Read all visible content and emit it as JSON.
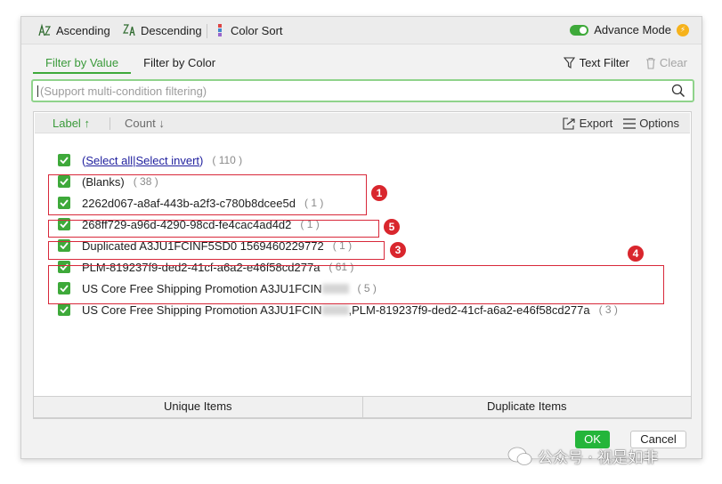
{
  "toolbar": {
    "ascending": "Ascending",
    "descending": "Descending",
    "color_sort": "Color Sort",
    "advance_mode": "Advance Mode"
  },
  "tabs": {
    "filter_by_value": "Filter by Value",
    "filter_by_color": "Filter by Color",
    "text_filter": "Text Filter",
    "clear": "Clear"
  },
  "search": {
    "placeholder": "(Support multi-condition filtering)"
  },
  "list_header": {
    "label": "Label",
    "count": "Count",
    "export": "Export",
    "options": "Options"
  },
  "rows": [
    {
      "pre": "(",
      "select_all": "Select all",
      "divider": "|",
      "select_invert": "Select invert",
      "post": ")",
      "count": "( 110 )"
    },
    {
      "text": "(Blanks)",
      "count": "( 38 )"
    },
    {
      "text": "2262d067-a8af-443b-a2f3-c780b8dcee5d",
      "count": "( 1 )"
    },
    {
      "text": "268ff729-a96d-4290-98cd-fe4cac4ad4d2",
      "count": "( 1 )"
    },
    {
      "text": "Duplicated A3JU1FCINF5SD0 1569460229772",
      "count": "( 1 )"
    },
    {
      "text": "PLM-819237f9-ded2-41cf-a6a2-e46f58cd277a",
      "count": "( 61 )"
    },
    {
      "text": "US Core Free Shipping Promotion A3JU1FCIN",
      "count": "( 5 )"
    },
    {
      "text": "US Core Free Shipping Promotion A3JU1FCIN",
      "text_tail": ",PLM-819237f9-ded2-41cf-a6a2-e46f58cd277a",
      "count": "( 3 )"
    }
  ],
  "annotations": [
    "1",
    "5",
    "3",
    "4"
  ],
  "bottom": {
    "unique_items": "Unique Items",
    "duplicate_items": "Duplicate Items"
  },
  "buttons": {
    "ok": "OK",
    "cancel": "Cancel"
  },
  "watermark": "公众号 · 视是如非",
  "colors": {
    "accent_green": "#3ea93a",
    "annotation_red": "#d9262d",
    "link_blue": "#1f1f9e"
  }
}
